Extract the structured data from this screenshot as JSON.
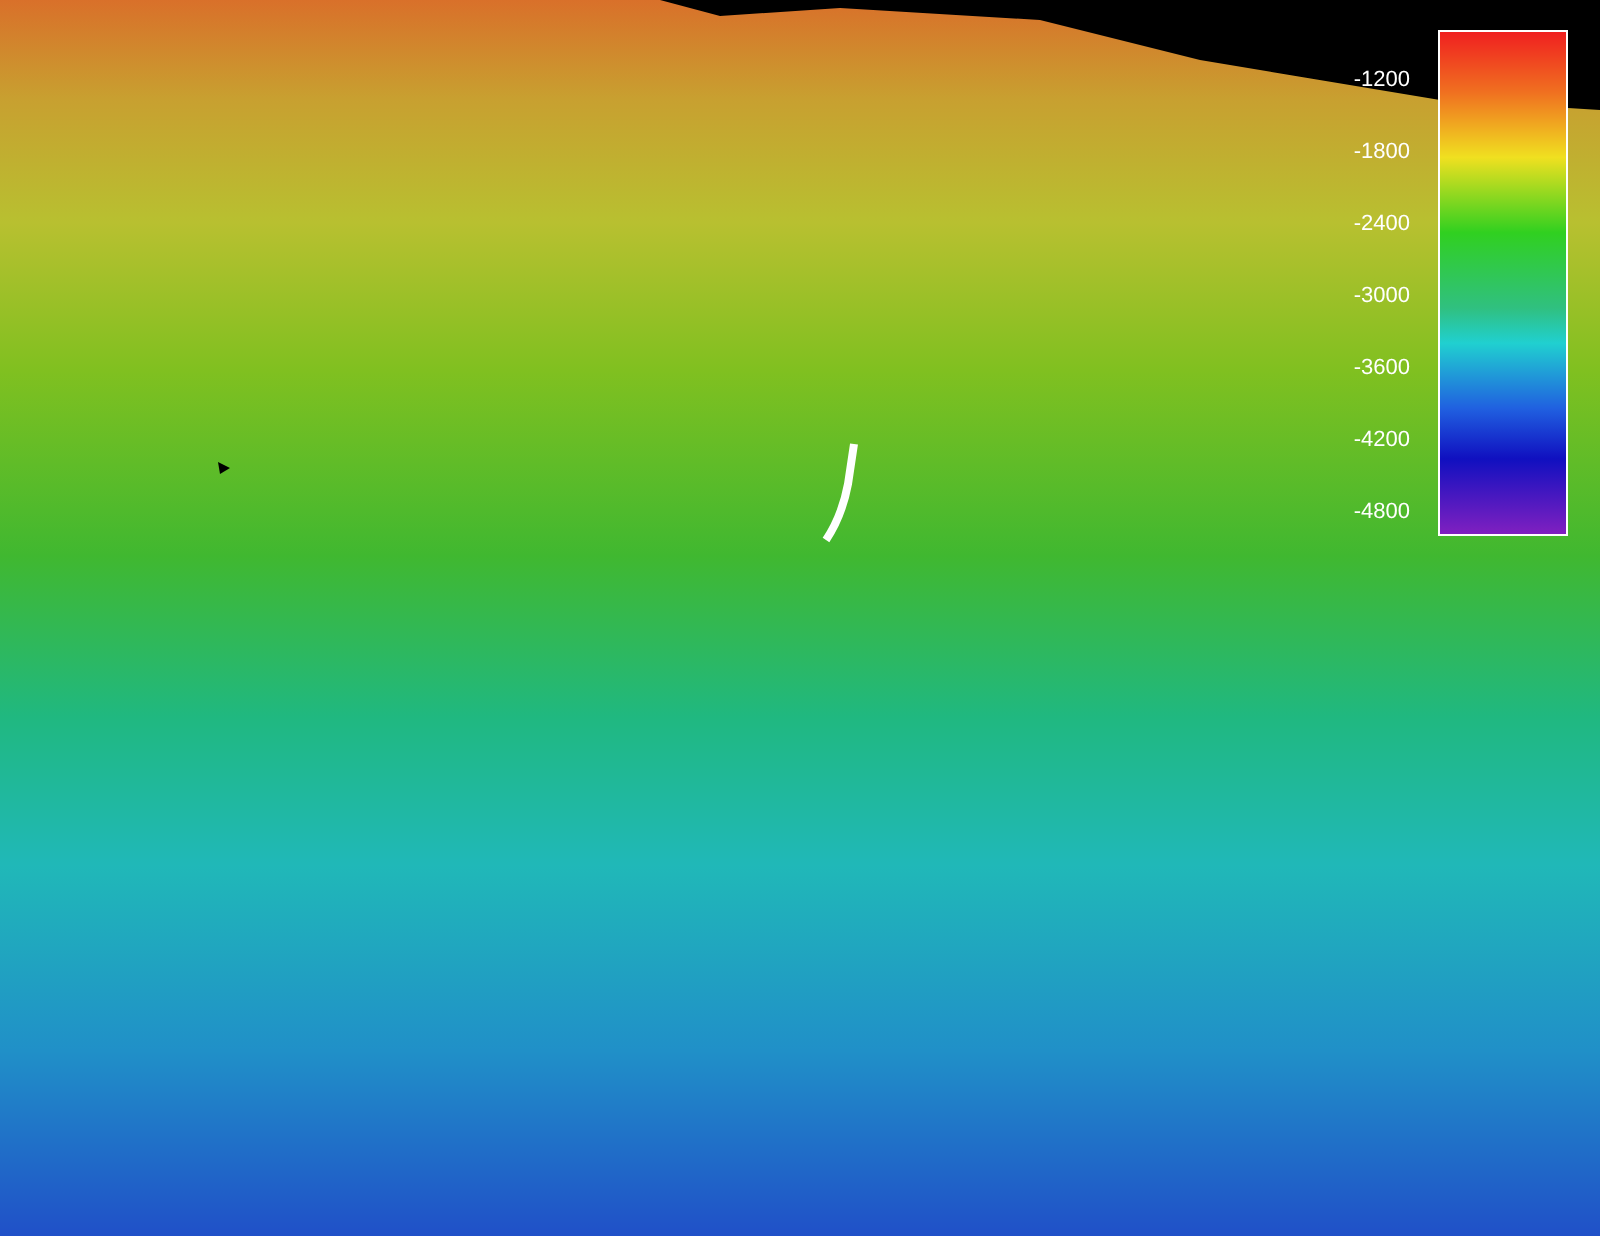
{
  "legend": {
    "ticks": [
      "-1200",
      "-1800",
      "-2400",
      "-3000",
      "-3600",
      "-4200",
      "-4800"
    ]
  }
}
